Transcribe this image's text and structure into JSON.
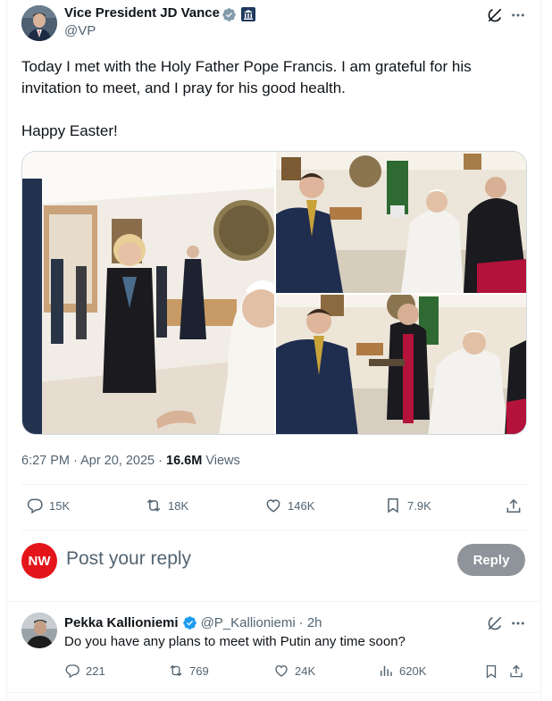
{
  "post": {
    "author_name": "Vice President JD Vance",
    "handle": "@VP",
    "text_line1": "Today I met with the Holy Father Pope Francis. I am grateful for his",
    "text_line2": "invitation to meet, and I pray for his good health.",
    "text_line3": "Happy Easter!",
    "time": "6:27 PM · Apr 20, 2025",
    "views_count": "16.6M",
    "views_label": "Views",
    "stats": {
      "replies": "15K",
      "reposts": "18K",
      "likes": "146K",
      "bookmarks": "7.9K"
    }
  },
  "compose": {
    "avatar_text": "NW",
    "placeholder": "Post your reply",
    "reply_label": "Reply"
  },
  "reply": {
    "author_name": "Pekka Kallioniemi",
    "handle": "@P_Kallioniemi",
    "time": "· 2h",
    "text": "Do you have any plans to meet with Putin any time soon?",
    "stats": {
      "replies": "221",
      "reposts": "769",
      "likes": "24K",
      "views": "620K"
    }
  },
  "colors": {
    "verified_blue": "#1d9bf0",
    "secondary_text": "#536471",
    "nw_red": "#e3151a",
    "reply_button": "#8e9499",
    "cardinal_red": "#b3123a"
  },
  "icons": [
    "verified-badge-icon",
    "government-building-icon",
    "grok-icon",
    "more-icon",
    "reply-icon",
    "repost-icon",
    "like-icon",
    "bookmark-icon",
    "share-icon",
    "views-icon"
  ]
}
